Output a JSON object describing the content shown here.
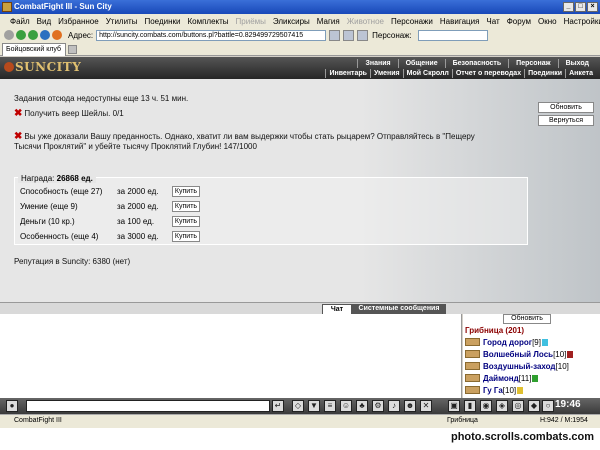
{
  "window": {
    "title": "CombatFight III - Sun City"
  },
  "menu": {
    "items": [
      "Файл",
      "Вид",
      "Избранное",
      "Утилиты",
      "Поединки",
      "Комплекты"
    ],
    "disabled1": "Приёмы",
    "items2": [
      "Эликсиры",
      "Магия"
    ],
    "disabled2": "Животное",
    "items3": [
      "Персонажи",
      "Навигация",
      "Чат",
      "Форум",
      "Окно",
      "Настройки"
    ]
  },
  "address": {
    "label": "Адрес:",
    "url": "http://suncity.combats.com/buttons.pl?battle=0.829499729507415",
    "persona_label": "Персонаж:"
  },
  "tab": {
    "label": "Бойцовский клуб"
  },
  "game": {
    "logo": "SUNCITY",
    "nav_top": [
      "Знания",
      "Общение",
      "Безопасность",
      "Персонаж",
      "Выход"
    ],
    "nav_bottom": [
      "Инвентарь",
      "Умения",
      "Мой Скролл",
      "Отчет о переводах",
      "Поединки",
      "Анкета"
    ]
  },
  "quest": {
    "unavailable": "Задания отсюда недоступны еще 13 ч. 51 мин.",
    "task1": "Получить веер Шейлы. 0/1",
    "task2_line1": "Вы уже доказали Вашу преданность. Однако, хватит ли вам выдержки чтобы стать рыцарем? Отправляйтесь в \"Пещеру",
    "task2_line2": "Тысячи Проклятий\" и убейте тысячу Проклятий Глубин! 147/1000",
    "refresh_label": "Обновить",
    "back_label": "Вернуться",
    "reward_label": "Награда:",
    "reward_value": "26868 ед.",
    "rows": [
      {
        "name": "Способность (еще 27)",
        "price": "за 2000 ед.",
        "buy": "Купить"
      },
      {
        "name": "Умение (еще 9)",
        "price": "за 2000 ед.",
        "buy": "Купить"
      },
      {
        "name": "Деньги (10 кр.)",
        "price": "за 100 ед.",
        "buy": "Купить"
      },
      {
        "name": "Особенность (еще 4)",
        "price": "за 3000 ед.",
        "buy": "Купить"
      }
    ],
    "reputation": "Репутация в Suncity: 6380 (нет)"
  },
  "chat": {
    "tab_chat": "Чат",
    "tab_system": "Системные сообщения",
    "refresh": "Обновить",
    "room": "Грибница (201)",
    "users": [
      {
        "name": "Город дорог",
        "level": "[9]"
      },
      {
        "name": "Волшебный Лось",
        "level": "[10]"
      },
      {
        "name": "Воздушный-заход",
        "level": "[10]"
      },
      {
        "name": "Даймонд",
        "level": "[11]"
      },
      {
        "name": "Гу Га",
        "level": "[10]"
      }
    ],
    "clock": "19:46"
  },
  "status": {
    "left": "CombatFight III",
    "location": "Грибница",
    "hp": "H:942 / M:1954"
  },
  "watermark": "photo.scrolls.combats.com"
}
